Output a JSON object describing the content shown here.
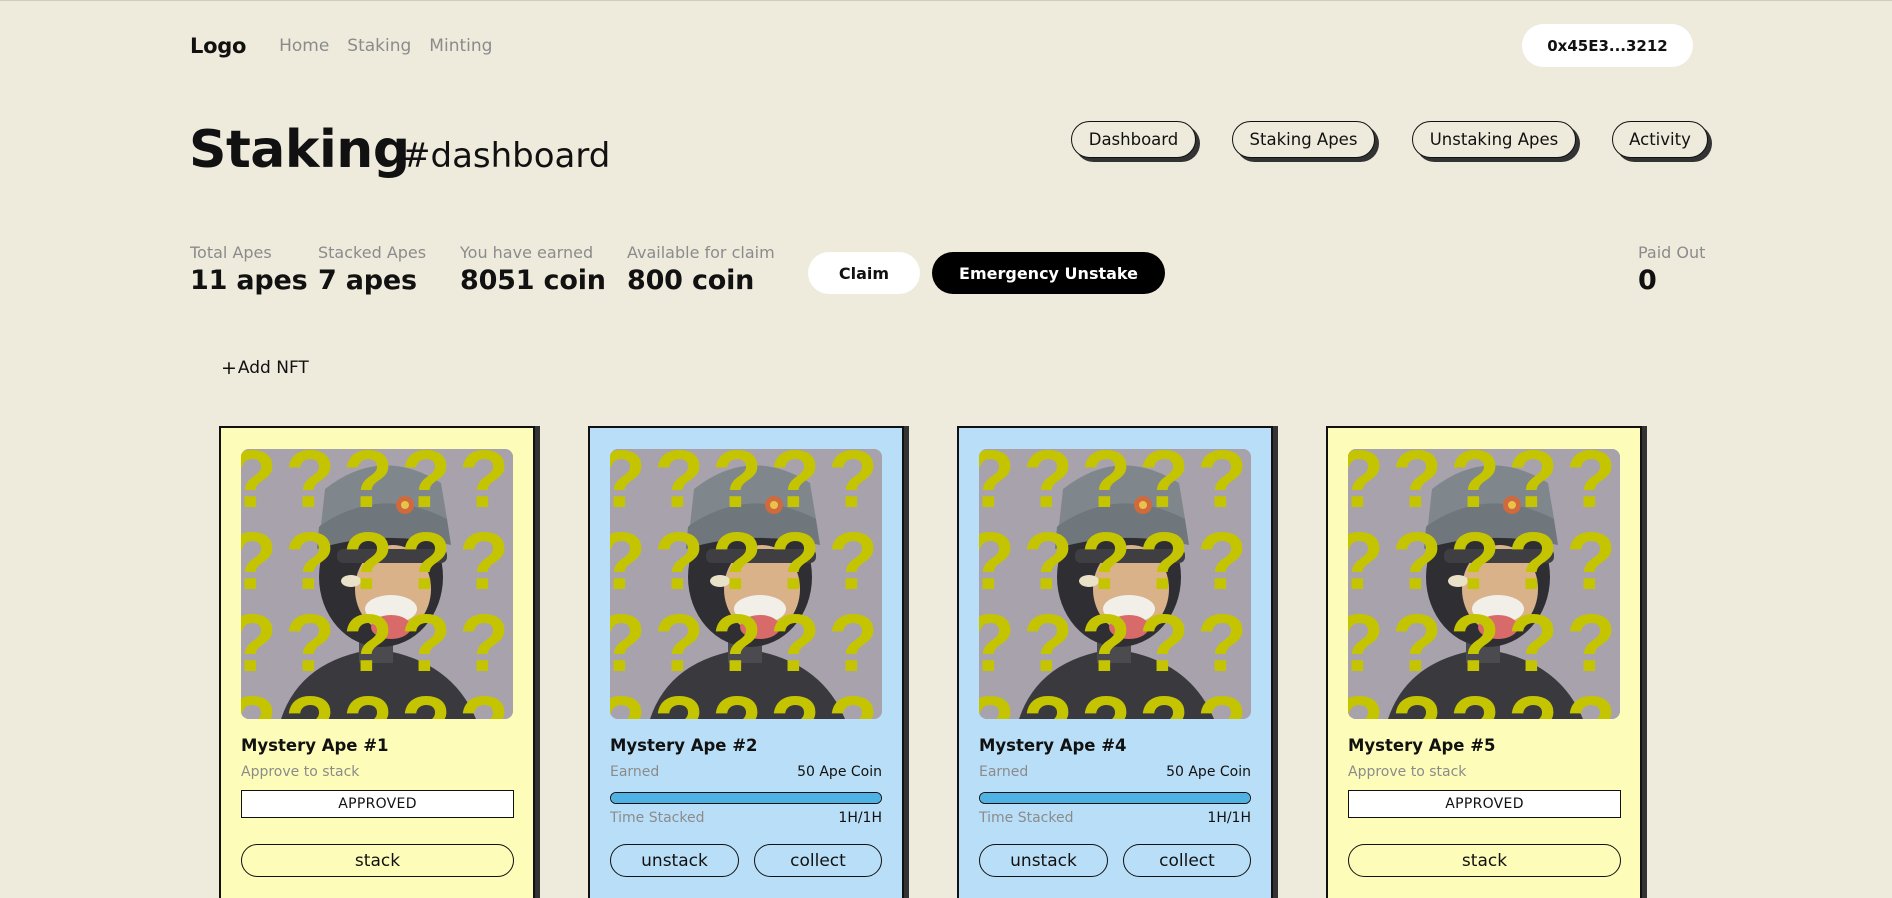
{
  "nav": {
    "logo": "Logo",
    "links": [
      "Home",
      "Staking",
      "Minting"
    ],
    "wallet": "0x45E3...3212"
  },
  "header": {
    "title": "Staking",
    "subtitle": "#dashboard",
    "tabs": [
      "Dashboard",
      "Staking Apes",
      "Unstaking Apes",
      "Activity"
    ]
  },
  "stats": [
    {
      "label": "Total Apes",
      "value": "11 apes"
    },
    {
      "label": "Stacked Apes",
      "value": "7 apes"
    },
    {
      "label": "You have earned",
      "value": "8051 coin"
    },
    {
      "label": "Available for claim",
      "value": "800 coin"
    }
  ],
  "paid_out": {
    "label": "Paid Out",
    "value": "0"
  },
  "actions": {
    "claim": "Claim",
    "emergency": "Emergency Unstake"
  },
  "add_nft": {
    "plus": "+",
    "label": "Add NFT"
  },
  "cards": [
    {
      "name": "Mystery Ape #1",
      "sub": "Approve to stack",
      "status": "APPROVED",
      "button": "stack",
      "color": "#fdfdb9"
    },
    {
      "name": "Mystery Ape #2",
      "earned_label": "Earned",
      "earned_value": "50 Ape Coin",
      "progress": 1.0,
      "time_label": "Time Stacked",
      "time_value": "1H/1H",
      "buttons": [
        "unstack",
        "collect"
      ],
      "color": "#b9dff8"
    },
    {
      "name": "Mystery Ape #4",
      "earned_label": "Earned",
      "earned_value": "50 Ape Coin",
      "progress": 1.0,
      "time_label": "Time Stacked",
      "time_value": "1H/1H",
      "buttons": [
        "unstack",
        "collect"
      ],
      "color": "#b9dff8"
    },
    {
      "name": "Mystery Ape #5",
      "sub": "Approve to stack",
      "status": "APPROVED",
      "button": "stack",
      "color": "#fdfdb9"
    }
  ],
  "colors": {
    "background": "#eeebdd",
    "question_mark": "#c5c400",
    "progress": "#4fb2e5"
  }
}
